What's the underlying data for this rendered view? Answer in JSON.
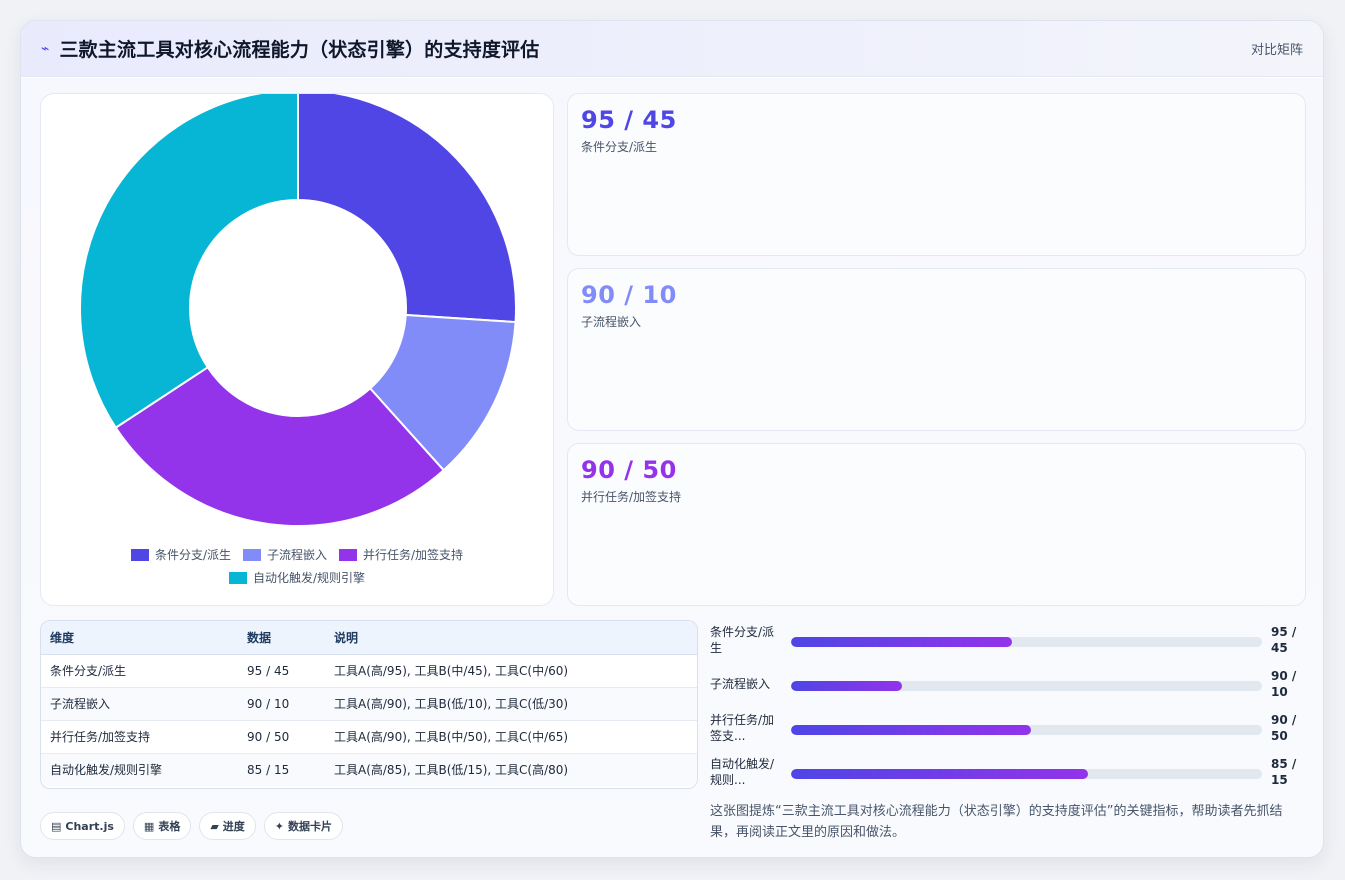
{
  "header": {
    "icon": "lightning-icon",
    "title": "三款主流工具对核心流程能力（状态引擎）的支持度评估",
    "link": "对比矩阵"
  },
  "chart_data": {
    "type": "pie",
    "donut": true,
    "categories": [
      "条件分支/派生",
      "子流程嵌入",
      "并行任务/加签支持",
      "自动化触发/规则引擎"
    ],
    "values": [
      95,
      45,
      100,
      125
    ],
    "colors": [
      "#4f46e5",
      "#818cf8",
      "#9333ea",
      "#06b6d4"
    ],
    "legend_position": "bottom"
  },
  "stats": [
    {
      "value": "95 / 45",
      "label": "条件分支/派生",
      "color": "#4f46e5"
    },
    {
      "value": "90 / 10",
      "label": "子流程嵌入",
      "color": "#818cf8"
    },
    {
      "value": "90 / 50",
      "label": "并行任务/加签支持",
      "color": "#9333ea"
    }
  ],
  "table": {
    "headers": [
      "维度",
      "数据",
      "说明"
    ],
    "rows": [
      [
        "条件分支/派生",
        "95 / 45",
        "工具A(高/95), 工具B(中/45), 工具C(中/60)"
      ],
      [
        "子流程嵌入",
        "90 / 10",
        "工具A(高/90), 工具B(低/10), 工具C(低/30)"
      ],
      [
        "并行任务/加签支持",
        "90 / 50",
        "工具A(高/90), 工具B(中/50), 工具C(中/65)"
      ],
      [
        "自动化触发/规则引擎",
        "85 / 15",
        "工具A(高/85), 工具B(低/15), 工具C(高/80)"
      ]
    ]
  },
  "bars": [
    {
      "label": "条件分支/派生",
      "value": "95 / 45",
      "fraction": 0.47
    },
    {
      "label": "子流程嵌入",
      "value": "90 / 10",
      "fraction": 0.235
    },
    {
      "label": "并行任务/加签支...",
      "value": "90 / 50",
      "fraction": 0.51
    },
    {
      "label": "自动化触发/规则...",
      "value": "85 / 15",
      "fraction": 0.63
    }
  ],
  "tags": [
    {
      "icon": "▤",
      "label": "Chart.js"
    },
    {
      "icon": "▦",
      "label": "表格"
    },
    {
      "icon": "▰",
      "label": "进度"
    },
    {
      "icon": "✦",
      "label": "数据卡片"
    }
  ],
  "caption": "这张图提炼“三款主流工具对核心流程能力（状态引擎）的支持度评估”的关键指标，帮助读者先抓结果，再阅读正文里的原因和做法。"
}
